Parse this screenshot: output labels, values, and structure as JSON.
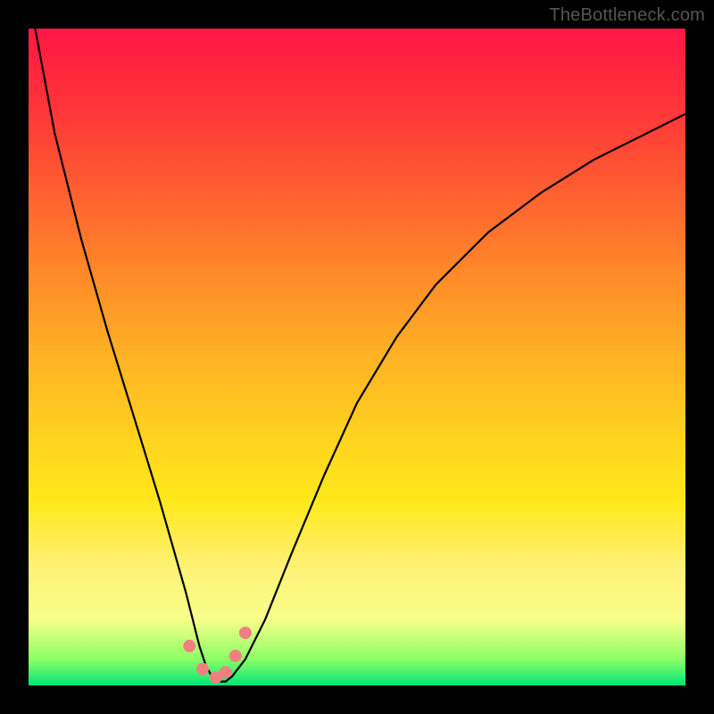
{
  "attribution": "TheBottleneck.com",
  "chart_data": {
    "type": "line",
    "title": "",
    "xlabel": "",
    "ylabel": "",
    "xlim": [
      0,
      100
    ],
    "ylim": [
      0,
      100
    ],
    "grid": false,
    "legend": false,
    "curve": {
      "name": "bottleneck-curve",
      "color": "#000000",
      "x": [
        1,
        4,
        8,
        12,
        16,
        20,
        22,
        24,
        25,
        26,
        27,
        28,
        29,
        30,
        31,
        33,
        36,
        40,
        45,
        50,
        56,
        62,
        70,
        78,
        86,
        94,
        100
      ],
      "y": [
        100,
        84,
        68,
        54,
        41,
        28,
        21,
        14,
        10,
        6,
        3,
        1.2,
        0.6,
        0.6,
        1.4,
        4,
        10,
        20,
        32,
        43,
        53,
        61,
        69,
        75,
        80,
        84,
        87
      ]
    },
    "sweet_spot_markers": {
      "name": "sweet-spot",
      "color": "#f08080",
      "points": [
        {
          "x": 24.5,
          "y": 6
        },
        {
          "x": 26.5,
          "y": 2.5
        },
        {
          "x": 28.5,
          "y": 1.2
        },
        {
          "x": 30.0,
          "y": 2.0
        },
        {
          "x": 31.5,
          "y": 4.5
        },
        {
          "x": 33.0,
          "y": 8.0
        }
      ]
    },
    "background_gradient": {
      "top": "#ff1744",
      "middle": "#ffd21f",
      "bottom": "#00e676"
    }
  }
}
